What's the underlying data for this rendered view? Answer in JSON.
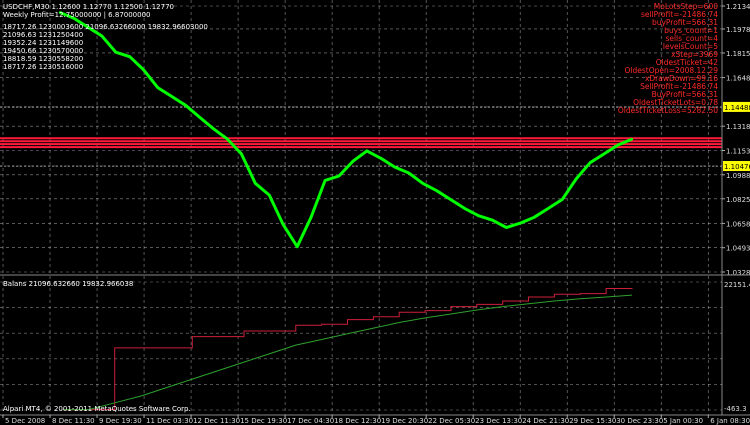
{
  "header": {
    "symbol_line": "USDCHF,M30  1.12600 1.12770 1.12500 1.12770",
    "weekly_profit": "Weekly Profit=12.75000000 | 6.87000000",
    "info_rows": [
      "18717.26  1230003600  21096.63266000  19832.96603000",
      "21096.63   1231250400",
      "19352.24   1231149600",
      "19450.66   1230570000",
      "18818.59   1230558200",
      "18717.26   1230516000"
    ]
  },
  "stats": [
    "MoLotsStep=600",
    "sellProfit=-21486.74",
    "buyProfit=566.31",
    "buys_count=1",
    "sells_count=4",
    "levelsCount=5",
    "xStep=3969",
    "OldestTicket=42",
    "OldestOpen=2008.12.29",
    "xDrawDown=99.16",
    "SellProfit=-21486.74",
    "BuyProfit=566.31",
    "OldestTicketLots=0.78",
    "OldestTicketLoss=5282.50"
  ],
  "indicator_label": "Balans 21096.632660 19832.966038",
  "indicator_value": "22151.4",
  "copyright": "Alpari MT4, © 2001-2011 MetaQuotes Software Corp.",
  "indicator_bottom_value": "-463.3",
  "colors": {
    "background": "#000000",
    "price_line": "#00ff00",
    "grid": "#ffffff",
    "level_lines": "#ff1a3c",
    "balance_line": "#cc1f3a",
    "equity_line": "#2ea02e",
    "price_tag_bg": "#ffff00",
    "stats_text": "#ff2a2a"
  },
  "chart_data": [
    {
      "type": "line",
      "title": "USDCHF,M30",
      "x": [
        "5 Dec 2008",
        "8 Dec 11:30",
        "9 Dec 19:30",
        "11 Dec 03:30",
        "12 Dec 11:30",
        "15 Dec 19:30",
        "17 Dec 04:30",
        "18 Dec 12:30",
        "19 Dec 20:30",
        "22 Dec 05:30",
        "23 Dec 13:30",
        "24 Dec 21:30",
        "29 Dec 15:30",
        "30 Dec 23:30",
        "5 Jan 00:30",
        "6 Jan 08:30"
      ],
      "y_ticks": [
        "1.21340",
        "1.19780",
        "1.18150",
        "1.16480",
        "1.14488",
        "1.13180",
        "1.11530",
        "1.10476",
        "1.09880",
        "1.08250",
        "1.06580",
        "1.04930",
        "1.03280"
      ],
      "ylim": [
        1.0328,
        1.2134
      ],
      "price_levels": [
        1.1448,
        1.1236,
        1.1216,
        1.1196,
        1.1176,
        1.1047
      ],
      "highlighted_prices": [
        "1.14488",
        "1.10476"
      ],
      "series": [
        {
          "values": [
            1.209,
            1.205,
            1.199,
            1.193,
            1.182,
            1.179,
            1.17,
            1.158,
            1.152,
            1.146,
            1.138,
            1.13,
            1.123,
            1.113,
            1.093,
            1.085,
            1.065,
            1.05,
            1.07,
            1.095,
            1.098,
            1.108,
            1.115,
            1.11,
            1.104,
            1.1,
            1.093,
            1.088,
            1.082,
            1.076,
            1.071,
            1.068,
            1.063,
            1.066,
            1.07,
            1.076,
            1.082,
            1.096,
            1.107,
            1.113,
            1.119,
            1.123
          ]
        }
      ]
    },
    {
      "type": "line",
      "title": "Balans",
      "ylim": [
        -463.3,
        22151.4
      ],
      "series": [
        {
          "name": "Balans",
          "values": [
            -400,
            -400,
            10500,
            10500,
            10500,
            12500,
            12500,
            13500,
            13500,
            14500,
            14700,
            15500,
            16000,
            16800,
            17100,
            17800,
            18200,
            18800,
            19500,
            20000,
            20100,
            21000,
            21096
          ]
        },
        {
          "values": [
            -400,
            -400,
            800,
            2000,
            3500,
            5000,
            6500,
            8000,
            9500,
            11000,
            12000,
            13000,
            14000,
            15000,
            15800,
            16500,
            17200,
            17800,
            18300,
            18800,
            19200,
            19500,
            19833
          ]
        }
      ]
    }
  ]
}
